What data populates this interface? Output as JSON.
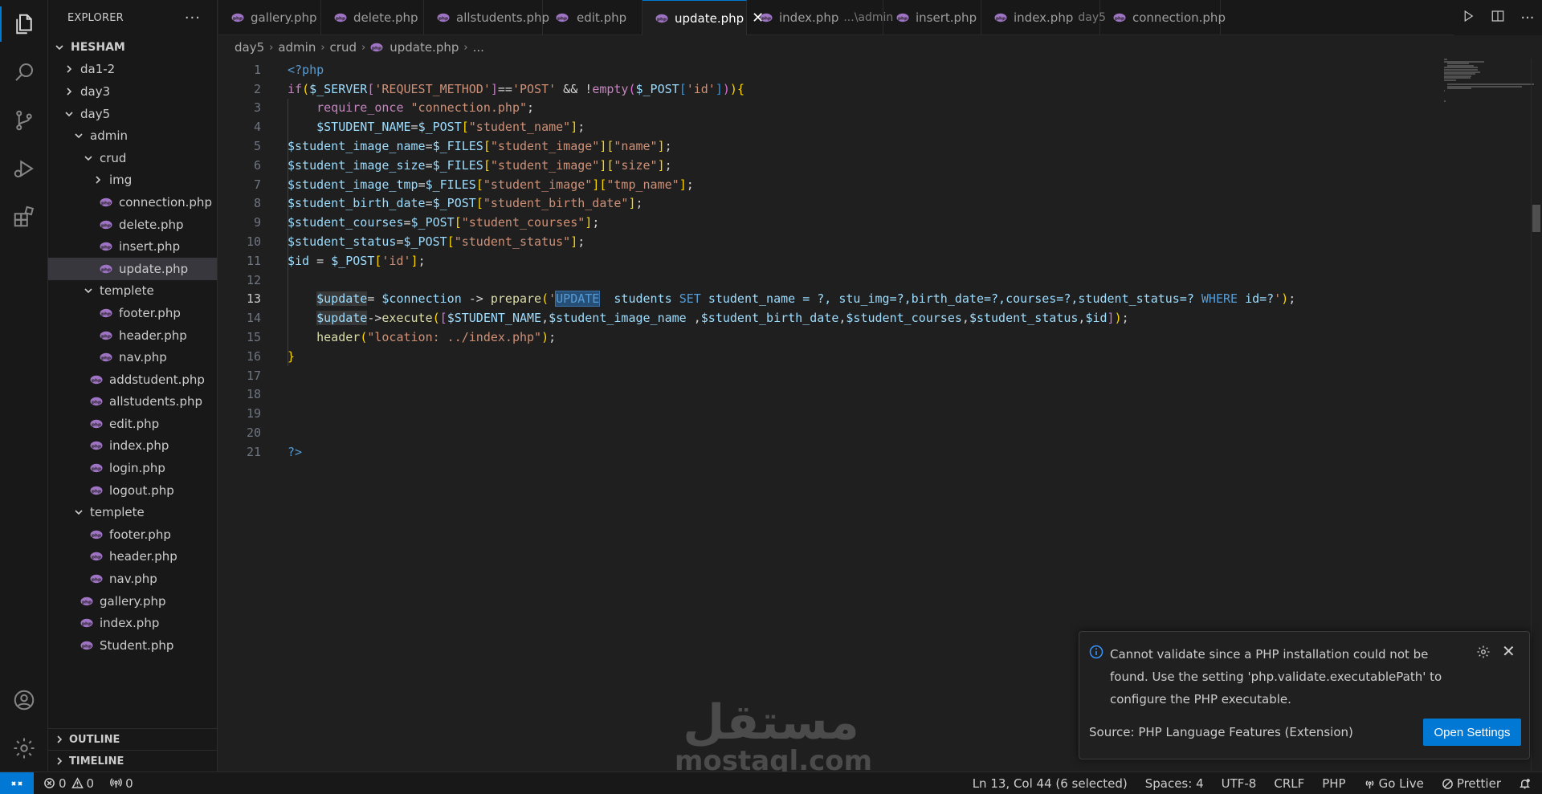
{
  "sidebar": {
    "title": "EXPLORER",
    "more": "···",
    "tree": [
      {
        "label": "HESHAM",
        "depth": 0,
        "type": "root",
        "open": true
      },
      {
        "label": "da1-2",
        "depth": 1,
        "type": "folder",
        "open": false
      },
      {
        "label": "day3",
        "depth": 1,
        "type": "folder",
        "open": false
      },
      {
        "label": "day5",
        "depth": 1,
        "type": "folder",
        "open": true
      },
      {
        "label": "admin",
        "depth": 2,
        "type": "folder",
        "open": true
      },
      {
        "label": "crud",
        "depth": 3,
        "type": "folder",
        "open": true
      },
      {
        "label": "img",
        "depth": 4,
        "type": "folder",
        "open": false
      },
      {
        "label": "connection.php",
        "depth": 4,
        "type": "php"
      },
      {
        "label": "delete.php",
        "depth": 4,
        "type": "php"
      },
      {
        "label": "insert.php",
        "depth": 4,
        "type": "php"
      },
      {
        "label": "update.php",
        "depth": 4,
        "type": "php",
        "selected": true
      },
      {
        "label": "templete",
        "depth": 3,
        "type": "folder",
        "open": true
      },
      {
        "label": "footer.php",
        "depth": 4,
        "type": "php"
      },
      {
        "label": "header.php",
        "depth": 4,
        "type": "php"
      },
      {
        "label": "nav.php",
        "depth": 4,
        "type": "php"
      },
      {
        "label": "addstudent.php",
        "depth": 3,
        "type": "php"
      },
      {
        "label": "allstudents.php",
        "depth": 3,
        "type": "php"
      },
      {
        "label": "edit.php",
        "depth": 3,
        "type": "php"
      },
      {
        "label": "index.php",
        "depth": 3,
        "type": "php"
      },
      {
        "label": "login.php",
        "depth": 3,
        "type": "php"
      },
      {
        "label": "logout.php",
        "depth": 3,
        "type": "php"
      },
      {
        "label": "templete",
        "depth": 2,
        "type": "folder",
        "open": true
      },
      {
        "label": "footer.php",
        "depth": 3,
        "type": "php"
      },
      {
        "label": "header.php",
        "depth": 3,
        "type": "php"
      },
      {
        "label": "nav.php",
        "depth": 3,
        "type": "php"
      },
      {
        "label": "gallery.php",
        "depth": 2,
        "type": "php"
      },
      {
        "label": "index.php",
        "depth": 2,
        "type": "php"
      },
      {
        "label": "Student.php",
        "depth": 2,
        "type": "php"
      }
    ],
    "outline_label": "OUTLINE",
    "timeline_label": "TIMELINE"
  },
  "tabs": [
    {
      "label": "gallery.php",
      "desc": ""
    },
    {
      "label": "delete.php",
      "desc": ""
    },
    {
      "label": "allstudents.php",
      "desc": ""
    },
    {
      "label": "edit.php",
      "desc": ""
    },
    {
      "label": "update.php",
      "desc": "",
      "active": true
    },
    {
      "label": "index.php",
      "desc": "...\\admin"
    },
    {
      "label": "insert.php",
      "desc": ""
    },
    {
      "label": "index.php",
      "desc": "day5"
    },
    {
      "label": "connection.php",
      "desc": ""
    }
  ],
  "breadcrumb": {
    "parts": [
      "day5",
      "admin",
      "crud",
      "update.php",
      "..."
    ]
  },
  "editor": {
    "active_line": 13,
    "lines": [
      "<?php",
      "if($_SERVER['REQUEST_METHOD']=='POST' && !empty($_POST['id'])){",
      "    require_once \"connection.php\";",
      "    $STUDENT_NAME=$_POST[\"student_name\"];",
      "$student_image_name=$_FILES[\"student_image\"][\"name\"];",
      "$student_image_size=$_FILES[\"student_image\"][\"size\"];",
      "$student_image_tmp=$_FILES[\"student_image\"][\"tmp_name\"];",
      "$student_birth_date=$_POST[\"student_birth_date\"];",
      "$student_courses=$_POST[\"student_courses\"];",
      "$student_status=$_POST[\"student_status\"];",
      "$id = $_POST['id'];",
      "",
      "    $update= $connection -> prepare('UPDATE  students SET student_name = ?, stu_img=?,birth_date=?,courses=?,student_status=? WHERE id=?');",
      "    $update->execute([$STUDENT_NAME,$student_image_name ,$student_birth_date,$student_courses,$student_status,$id]);",
      "    header(\"location: ../index.php\");",
      "}",
      "",
      "",
      "",
      "",
      "?>"
    ]
  },
  "notification": {
    "message": "Cannot validate since a PHP installation could not be found. Use the setting 'php.validate.executablePath' to configure the PHP executable.",
    "source": "Source: PHP Language Features (Extension)",
    "button_label": "Open Settings",
    "close_glyph": "✕"
  },
  "watermark": {
    "arabic": "مستقل",
    "latin": "mostaql.com"
  },
  "statusbar": {
    "errors": "0",
    "warnings": "0",
    "ports": "0",
    "position": "Ln 13, Col 44 (6 selected)",
    "spaces": "Spaces: 4",
    "encoding": "UTF-8",
    "eol": "CRLF",
    "language": "PHP",
    "golive": "Go Live",
    "prettier": "Prettier"
  },
  "colors": {
    "accent": "#0078d4",
    "php_icon": "#a074c4"
  }
}
